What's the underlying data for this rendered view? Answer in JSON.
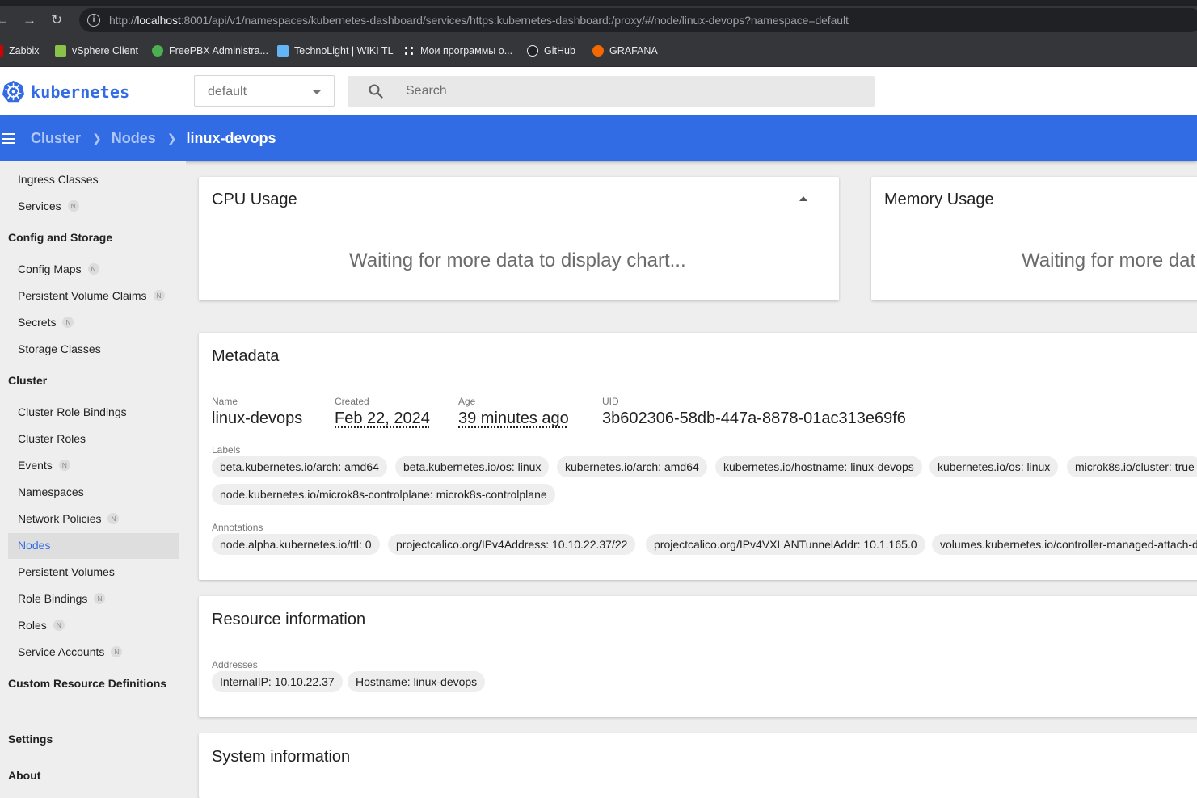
{
  "browser": {
    "url_prefix": "http://",
    "url_host": "localhost",
    "url_rest": ":8001/api/v1/namespaces/kubernetes-dashboard/services/https:kubernetes-dashboard:/proxy/#/node/linux-devops?namespace=default",
    "bookmarks": [
      {
        "label": "Zabbix",
        "icon": "zabbix-icon",
        "color": "#d40000"
      },
      {
        "label": "vSphere Client",
        "icon": "vsphere-icon",
        "color": "#8bc34a"
      },
      {
        "label": "FreePBX Administra...",
        "icon": "freepbx-icon",
        "color": "#4caf50"
      },
      {
        "label": "TechnoLight | WIKI TL",
        "icon": "technolight-icon",
        "color": "#64b5f6"
      },
      {
        "label": "Мои программы о...",
        "icon": "apps-grid-icon",
        "color": "#ffffff"
      },
      {
        "label": "GitHub",
        "icon": "github-icon",
        "color": "#ffffff"
      },
      {
        "label": "GRAFANA",
        "icon": "grafana-icon",
        "color": "#f46800"
      }
    ]
  },
  "toolbar": {
    "logo_text": "kubernetes",
    "namespace": "default",
    "search_placeholder": "Search",
    "brand_color": "#326ce5"
  },
  "breadcrumb": [
    "Cluster",
    "Nodes",
    "linux-devops"
  ],
  "sidebar": {
    "items_top": [
      {
        "label": "Ingress Classes",
        "badge": ""
      },
      {
        "label": "Services",
        "badge": "N"
      }
    ],
    "group_config": "Config and Storage",
    "config_items": [
      {
        "label": "Config Maps",
        "badge": "N"
      },
      {
        "label": "Persistent Volume Claims",
        "badge": "N"
      },
      {
        "label": "Secrets",
        "badge": "N"
      },
      {
        "label": "Storage Classes",
        "badge": ""
      }
    ],
    "group_cluster": "Cluster",
    "cluster_items": [
      {
        "label": "Cluster Role Bindings",
        "badge": ""
      },
      {
        "label": "Cluster Roles",
        "badge": ""
      },
      {
        "label": "Events",
        "badge": "N"
      },
      {
        "label": "Namespaces",
        "badge": ""
      },
      {
        "label": "Network Policies",
        "badge": "N"
      },
      {
        "label": "Nodes",
        "badge": "",
        "active": true
      },
      {
        "label": "Persistent Volumes",
        "badge": ""
      },
      {
        "label": "Role Bindings",
        "badge": "N"
      },
      {
        "label": "Roles",
        "badge": "N"
      },
      {
        "label": "Service Accounts",
        "badge": "N"
      }
    ],
    "group_crd": "Custom Resource Definitions",
    "settings": "Settings",
    "about": "About"
  },
  "cpu_card": {
    "title": "CPU Usage",
    "message": "Waiting for more data to display chart..."
  },
  "memory_card": {
    "title": "Memory Usage",
    "message": "Waiting for more dat"
  },
  "metadata": {
    "title": "Metadata",
    "name_label": "Name",
    "name": "linux-devops",
    "created_label": "Created",
    "created": "Feb 22, 2024",
    "age_label": "Age",
    "age": "39 minutes ago",
    "uid_label": "UID",
    "uid": "3b602306-58db-447a-8878-01ac313e69f6",
    "labels_label": "Labels",
    "labels": [
      "beta.kubernetes.io/arch: amd64",
      "beta.kubernetes.io/os: linux",
      "kubernetes.io/arch: amd64",
      "kubernetes.io/hostname: linux-devops",
      "kubernetes.io/os: linux",
      "microk8s.io/cluster: true",
      "node.kubernetes.io/microk8s-controlplane: microk8s-controlplane"
    ],
    "annotations_label": "Annotations",
    "annotations": [
      "node.alpha.kubernetes.io/ttl: 0",
      "projectcalico.org/IPv4Address: 10.10.22.37/22",
      "projectcalico.org/IPv4VXLANTunnelAddr: 10.1.165.0",
      "volumes.kubernetes.io/controller-managed-attach-detach: true"
    ]
  },
  "resource": {
    "title": "Resource information",
    "addresses_label": "Addresses",
    "addresses": [
      "InternalIP: 10.10.22.37",
      "Hostname: linux-devops"
    ]
  },
  "system": {
    "title": "System information"
  }
}
